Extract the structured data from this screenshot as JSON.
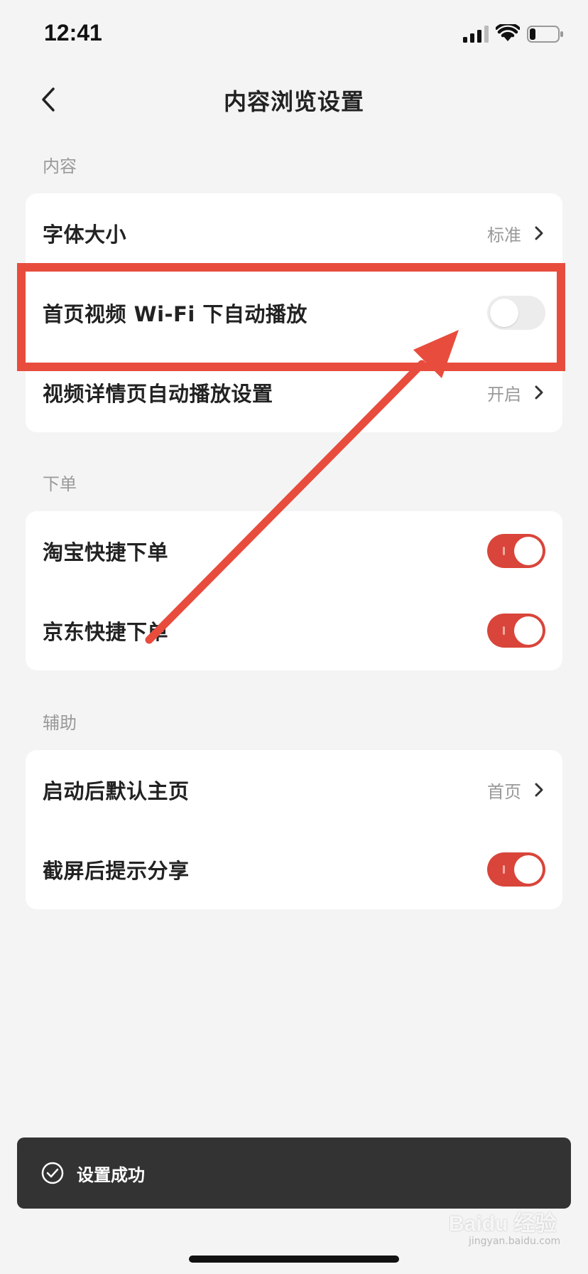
{
  "status_bar": {
    "time": "12:41"
  },
  "nav": {
    "title": "内容浏览设置"
  },
  "sections": {
    "content": {
      "label": "内容",
      "rows": [
        {
          "label": "字体大小",
          "value": "标准"
        },
        {
          "label": "首页视频 Wi-Fi 下自动播放",
          "toggle": false
        },
        {
          "label": "视频详情页自动播放设置",
          "value": "开启"
        }
      ]
    },
    "order": {
      "label": "下单",
      "rows": [
        {
          "label": "淘宝快捷下单",
          "toggle": true
        },
        {
          "label": "京东快捷下单",
          "toggle": true
        }
      ]
    },
    "assist": {
      "label": "辅助",
      "rows": [
        {
          "label": "启动后默认主页",
          "value": "首页"
        },
        {
          "label": "截屏后提示分享",
          "toggle": true
        }
      ]
    }
  },
  "toast": {
    "text": "设置成功"
  },
  "watermark": {
    "brand": "Baidu 经验",
    "url": "jingyan.baidu.com"
  },
  "colors": {
    "accent": "#d9453a",
    "annotation": "#e84c3d",
    "background": "#f4f4f4",
    "toast_bg": "#333333"
  }
}
